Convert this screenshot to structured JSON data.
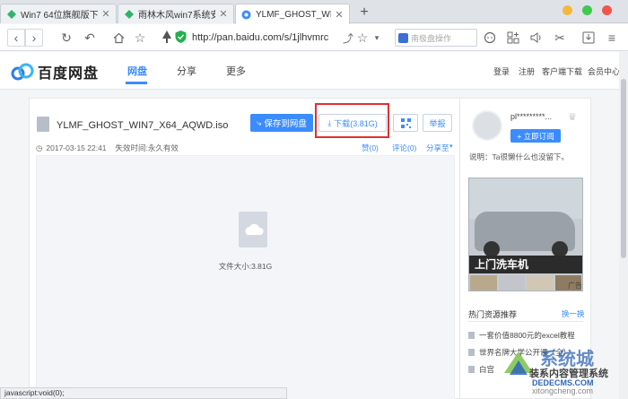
{
  "browser": {
    "tabs": [
      {
        "label": "Win7 64位旗舰版下载_...",
        "icon": "green-diamond-icon"
      },
      {
        "label": "雨林木风win7系统安装...",
        "icon": "green-diamond-icon"
      },
      {
        "label": "YLMF_GHOST_WIN7_...",
        "icon": "baidu-pan-icon"
      }
    ],
    "new_tab": "+",
    "url": "http://pan.baidu.com/s/1jlhvmrc",
    "search_placeholder": "南极盘操作",
    "status_text": "javascript:void(0);",
    "colors": {
      "close": "#f2554b",
      "minimize": "#f5b83d",
      "maximize": "#3fc950",
      "accent": "#3b8cff"
    }
  },
  "header": {
    "logo_text": "百度网盘",
    "nav": [
      "网盘",
      "分享",
      "更多"
    ],
    "top_links": [
      "登录",
      "注册",
      "客户端下载",
      "会员中心"
    ]
  },
  "file": {
    "name": "YLMF_GHOST_WIN7_X64_AQWD.iso",
    "save_label": "保存到网盘",
    "download_label": "下载(3.81G)",
    "report_label": "举报",
    "date": "2017-03-15 22:41",
    "expiry": "失效时间:永久有效",
    "links": [
      "赞(0)",
      "评论(0)",
      "分享至"
    ],
    "size_label": "文件大小:3.81G"
  },
  "sidebar": {
    "username": "pl*********...",
    "subscribe_label": "+ 立即订阅",
    "description": "说明：Ta很懒什么也没留下。",
    "ad_text": "上门洗车机",
    "ad_tag": "广告",
    "hot_title": "热门资源推荐",
    "hot_switch": "换一换",
    "hot_items": [
      "一套价值8800元的excel教程",
      "世界名牌大学公开课（全）",
      "白宫"
    ]
  },
  "watermark": {
    "line1": "系统城",
    "line2": "装系内容管理系统",
    "line3": "DEDECMS.COM",
    "line4": "xitongcheng.com"
  }
}
